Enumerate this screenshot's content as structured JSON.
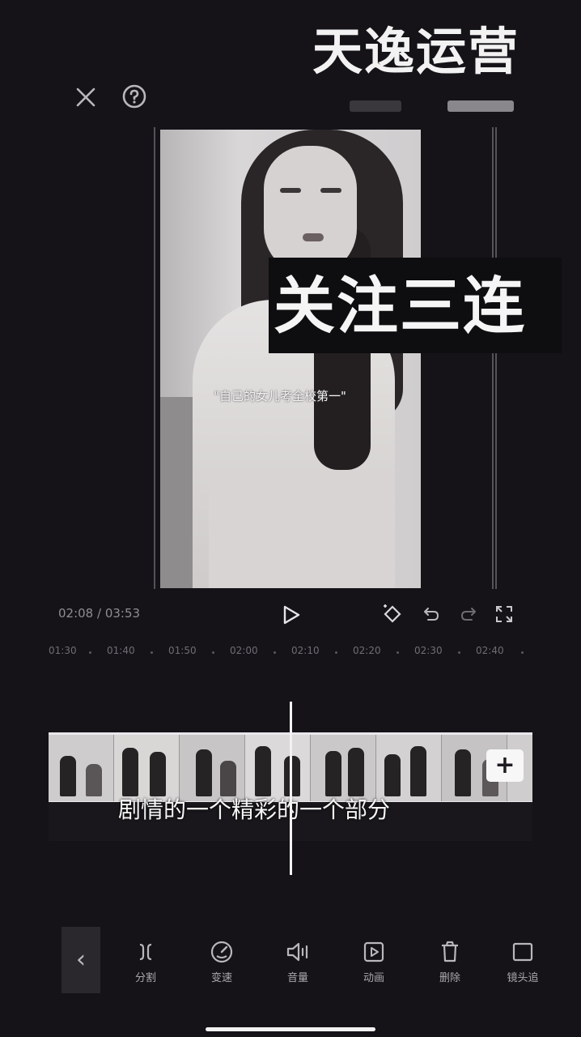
{
  "watermark": {
    "top_text": "天逸运营"
  },
  "header": {
    "close_icon": "close-icon",
    "help_icon": "help-icon"
  },
  "preview": {
    "video_caption": "\"自己的女儿考全校第一\"",
    "overlay_text": "关注三连"
  },
  "playback": {
    "time_current": "02:08",
    "time_separator": " / ",
    "time_total": "03:53",
    "play_icon": "play-icon",
    "keyframe_icon": "keyframe-icon",
    "undo_icon": "undo-icon",
    "redo_icon": "redo-icon",
    "fullscreen_icon": "fullscreen-icon"
  },
  "ruler": {
    "ticks": [
      "01:30",
      "01:40",
      "01:50",
      "02:00",
      "02:10",
      "02:20",
      "02:30",
      "02:40"
    ]
  },
  "timeline": {
    "subtitle": "剧情的一个精彩的一个部分",
    "add_label": "+"
  },
  "toolbar": {
    "back_label": "‹",
    "items": [
      {
        "label": "分割",
        "icon": "split-icon"
      },
      {
        "label": "变速",
        "icon": "speed-icon"
      },
      {
        "label": "音量",
        "icon": "volume-icon"
      },
      {
        "label": "动画",
        "icon": "animation-icon"
      },
      {
        "label": "删除",
        "icon": "delete-icon"
      },
      {
        "label": "镜头追",
        "icon": "tracking-icon"
      }
    ]
  },
  "colors": {
    "background": "#151318",
    "text": "#e8e6ea",
    "muted": "#8f8c92"
  }
}
